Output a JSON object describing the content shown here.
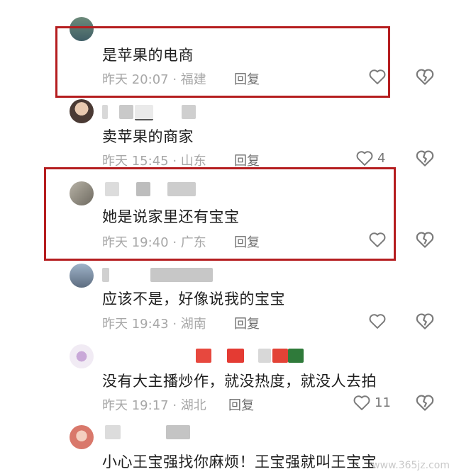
{
  "comments": [
    {
      "text": "是苹果的电商",
      "time": "昨天 20:07",
      "location": "福建",
      "reply": "回复",
      "likes": ""
    },
    {
      "text": "卖苹果的商家",
      "time": "昨天 15:45",
      "location": "山东",
      "reply": "回复",
      "likes": "4"
    },
    {
      "text": "她是说家里还有宝宝",
      "time": "昨天 19:40",
      "location": "广东",
      "reply": "回复",
      "likes": ""
    },
    {
      "text": "应该不是，好像说我的宝宝",
      "time": "昨天 19:43",
      "location": "湖南",
      "reply": "回复",
      "likes": ""
    },
    {
      "text": "没有大主播炒作，就没热度，就没人去拍",
      "time": "昨天 19:17",
      "location": "湖北",
      "reply": "回复",
      "likes": "11"
    },
    {
      "text": "小心王宝强找你麻烦！王宝强就叫王宝宝",
      "time": "",
      "location": "",
      "reply": "",
      "likes": ""
    }
  ],
  "separator": " · ",
  "watermark": "www.365jz.com",
  "colors": {
    "highlight": "#b51d1f",
    "meta": "#a7a7a7",
    "text": "#1e1e1e"
  },
  "icons": {
    "like": "heart-outline-icon",
    "dislike": "broken-heart-icon"
  }
}
